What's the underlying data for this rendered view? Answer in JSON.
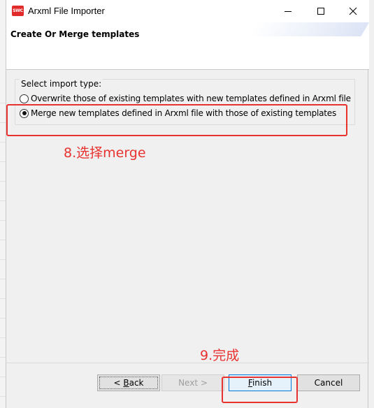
{
  "window": {
    "title": "Arxml File Importer",
    "app_icon_text": "SWC"
  },
  "header": {
    "title": "Create Or Merge templates"
  },
  "import_type": {
    "legend": "Select import type:",
    "options": [
      {
        "label": "Overwrite those of existing templates with new templates defined in Arxml file",
        "selected": false
      },
      {
        "label": "Merge new templates defined in Arxml file with those of existing templates",
        "selected": true
      }
    ]
  },
  "annotations": {
    "step8": "8.选择merge",
    "step9": "9.完成",
    "color": "#e8322f"
  },
  "buttons": {
    "back": {
      "prefix": "< ",
      "mnemonic": "B",
      "rest": "ack",
      "enabled": true
    },
    "next": {
      "label": "Next >",
      "enabled": false
    },
    "finish": {
      "mnemonic": "F",
      "rest": "inish",
      "enabled": true
    },
    "cancel": {
      "label": "Cancel",
      "enabled": true
    }
  },
  "icons": [
    "app-icon",
    "minimize-icon",
    "maximize-icon",
    "close-icon"
  ]
}
